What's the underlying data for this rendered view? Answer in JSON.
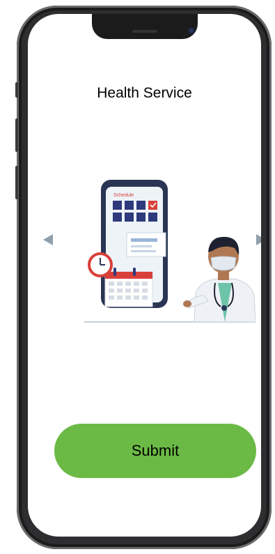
{
  "screen": {
    "title": "Health Service",
    "illustration": {
      "phone_header": "Schedule"
    },
    "nav": {
      "prev_icon": "triangle-left-icon",
      "next_icon": "triangle-right-icon"
    },
    "submit_label": "Submit"
  },
  "colors": {
    "submit": "#6cba46",
    "arrows": "#8f9fac",
    "calendar_red": "#d9403a",
    "grid_blue": "#2e3a7c"
  }
}
